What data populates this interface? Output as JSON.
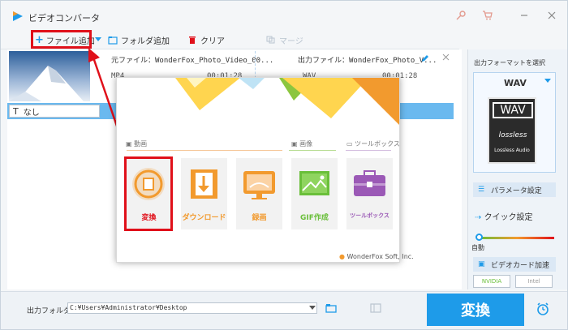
{
  "window": {
    "title": "ビデオコンバータ",
    "controls": [
      "key-icon",
      "cart-icon",
      "minimize-icon",
      "close-icon"
    ]
  },
  "toolbar": {
    "add_file": "ファイル追加",
    "add_folder": "フォルダ追加",
    "clear": "クリア",
    "merge": "マージ"
  },
  "file_item": {
    "source_label": "元ファイル：",
    "source_name": "WonderFox_Photo_Video_00...",
    "source_format": "MP4",
    "source_duration": "00:01:28",
    "output_label": "出力ファイル：",
    "output_name": "WonderFox_Photo_V...",
    "output_format": "WAV",
    "output_duration": "00:01:28",
    "subtitle_value": "なし"
  },
  "popup": {
    "sections": {
      "video": "動画",
      "image": "画像",
      "toolbox": "ツールボックス"
    },
    "tools": [
      {
        "label": "変換",
        "color": "#f29a2e"
      },
      {
        "label": "ダウンロード",
        "color": "#f29a2e"
      },
      {
        "label": "録画",
        "color": "#f29a2e"
      },
      {
        "label": "GIF作成",
        "color": "#6abf3a"
      },
      {
        "label": "ツールボックス",
        "color": "#9b59b6"
      }
    ],
    "credit": "WonderFox Soft, Inc."
  },
  "right_panel": {
    "format_title": "出力フォーマットを選択",
    "format_name": "WAV",
    "card_top": "WAV",
    "card_lossless": "lossless",
    "card_sub": "Lossless Audio",
    "param_button": "パラメータ設定",
    "quick_label": "クイック設定",
    "slider_label": "自動",
    "gpu_title": "ビデオカード加速",
    "gpu_nvidia": "NVIDIA",
    "gpu_intel": "Intel"
  },
  "bottom": {
    "output_label": "出力フォルダ：",
    "output_path": "C:¥Users¥Administrator¥Desktop",
    "convert": "変換"
  },
  "colors": {
    "accent": "#1e9be9",
    "highlight": "#e0101a",
    "orange": "#f29a2e",
    "green": "#6abf3a",
    "purple": "#9b59b6"
  }
}
